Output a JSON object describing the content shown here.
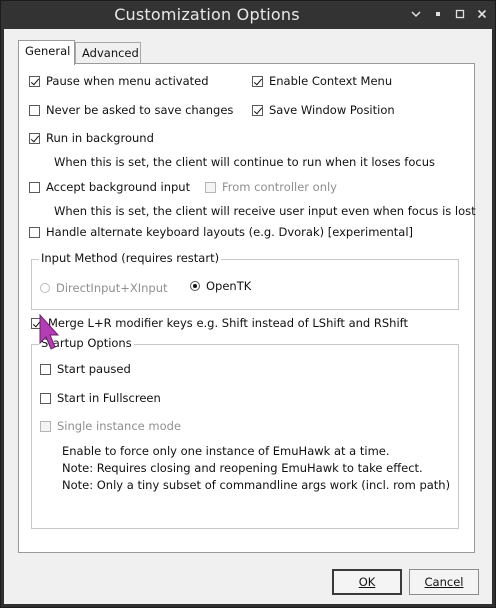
{
  "window": {
    "title": "Customization Options",
    "controls": [
      "chevron-down-icon",
      "minimize-icon",
      "maximize-icon",
      "close-icon"
    ]
  },
  "tabs": [
    {
      "label": "General",
      "active": true
    },
    {
      "label": "Advanced",
      "active": false
    }
  ],
  "general": {
    "pause_menu": {
      "label": "Pause when menu activated",
      "checked": true
    },
    "enable_context_menu": {
      "label": "Enable Context Menu",
      "checked": true
    },
    "never_save": {
      "label": "Never be asked to save changes",
      "checked": false
    },
    "save_window_position": {
      "label": "Save Window Position",
      "checked": true
    },
    "run_background": {
      "label": "Run in background",
      "checked": true
    },
    "run_background_note": "When this is set, the client will continue to run when it loses focus",
    "accept_bg_input": {
      "label": "Accept background input",
      "checked": false
    },
    "from_controller_only": {
      "label": "From controller only",
      "checked": false,
      "disabled": true
    },
    "accept_bg_input_note": "When this is set, the client will receive user input even when focus is lost",
    "alt_keyboard": {
      "label": "Handle alternate keyboard layouts (e.g. Dvorak) [experimental]",
      "checked": false
    },
    "input_method": {
      "title": "Input Method (requires restart)",
      "options": [
        {
          "label": "DirectInput+XInput",
          "selected": false,
          "disabled": true
        },
        {
          "label": "OpenTK",
          "selected": true,
          "disabled": false
        }
      ]
    },
    "merge_lr": {
      "label": "Merge L+R modifier keys e.g. Shift instead of LShift and RShift",
      "checked": true
    },
    "startup": {
      "title": "Startup Options",
      "start_paused": {
        "label": "Start paused",
        "checked": false
      },
      "start_fullscreen": {
        "label": "Start in Fullscreen",
        "checked": false
      },
      "single_instance": {
        "label": "Single instance mode",
        "checked": false,
        "disabled": true
      },
      "notes": [
        "Enable to force only one instance of EmuHawk at a time.",
        "Note: Requires closing and reopening EmuHawk to take effect.",
        "Note: Only a tiny subset of commandline args work (incl. rom path)"
      ]
    }
  },
  "buttons": {
    "ok": "OK",
    "cancel": "Cancel"
  },
  "colors": {
    "titlebar": "#333333",
    "dialog_bg": "#f0f0f0",
    "panel_bg": "#ffffff",
    "cursor": "#b43cb4"
  }
}
